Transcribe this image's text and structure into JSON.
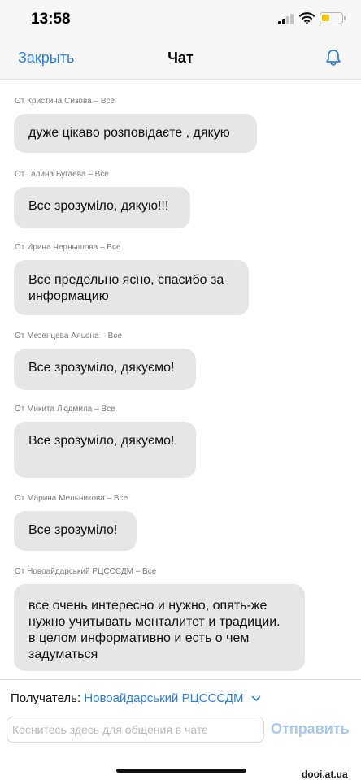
{
  "status_bar": {
    "time": "13:58",
    "signal_icon": "cellular-signal-icon",
    "wifi_icon": "wifi-icon",
    "battery_icon": "battery-icon",
    "battery_level": 0.4,
    "battery_color": "#f2c80f"
  },
  "nav": {
    "close_label": "Закрыть",
    "title": "Чат",
    "notify_icon": "bell-icon",
    "accent_color": "#2f7fd3"
  },
  "messages": [
    {
      "meta": "От Кристина Сизова – Все",
      "text": "дуже цікаво розповідаєте , дякую"
    },
    {
      "meta": "От Галина Бугаева – Все",
      "text": "Все зрозуміло, дякую!!!"
    },
    {
      "meta": "От Ирина Чернышова – Все",
      "text": "Все предельно ясно, спасибо за информацию"
    },
    {
      "meta": "От Мезенцева Альона – Все",
      "text": "Все зрозуміло, дякуємо!"
    },
    {
      "meta": "От Микита Людмила – Все",
      "text": "Все зрозуміло, дякуємо!"
    },
    {
      "meta": "От Марина Мельникова – Все",
      "text": "Все зрозуміло!"
    },
    {
      "meta": "От Новоайдарський РЦСССДМ – Все",
      "text": "все очень интересно и нужно, опять-же нужно учитывать менталитет и традиции. в целом информативно и есть о чем задуматься"
    }
  ],
  "composer": {
    "recipient_label": "Получатель:",
    "recipient_value": "Новоайдарський РЦСССДМ",
    "input_placeholder": "Коснитесь здесь для общения в чате",
    "input_value": "",
    "send_label": "Отправить"
  },
  "watermark": "dooi.at.ua"
}
